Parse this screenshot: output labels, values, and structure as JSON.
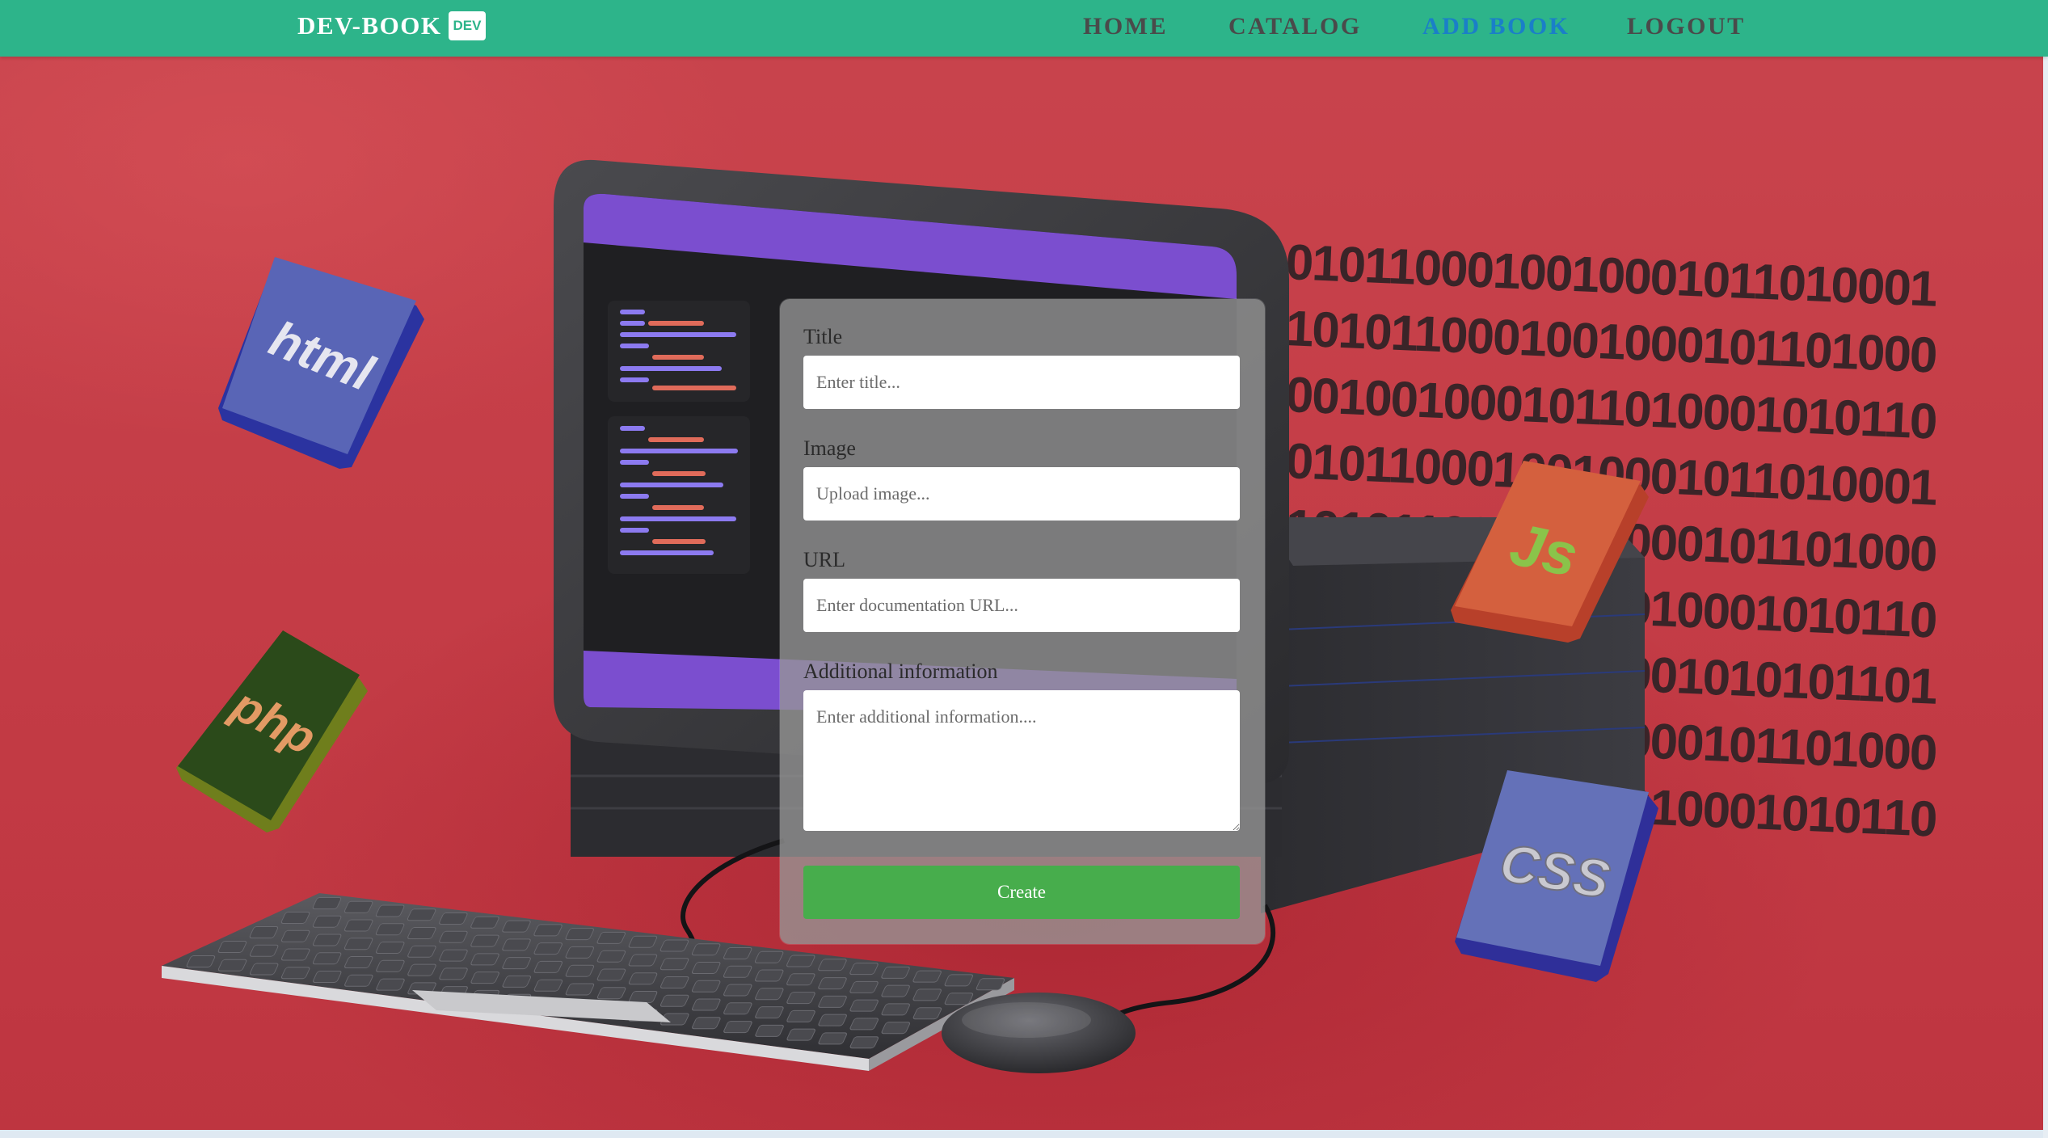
{
  "navbar": {
    "brand": "DEV-BOOK",
    "badge": "DEV",
    "links": [
      {
        "label": "HOME",
        "active": false
      },
      {
        "label": "CATALOG",
        "active": false
      },
      {
        "label": "ADD BOOK",
        "active": true
      },
      {
        "label": "LOGOUT",
        "active": false
      }
    ],
    "background_color": "#2db48a",
    "active_color": "#1a7fc8"
  },
  "form": {
    "title": {
      "label": "Title",
      "placeholder": "Enter title..."
    },
    "image": {
      "label": "Image",
      "placeholder": "Upload image..."
    },
    "url": {
      "label": "URL",
      "placeholder": "Enter documentation URL..."
    },
    "additional": {
      "label": "Additional information",
      "placeholder": "Enter additional information...."
    },
    "submit_label": "Create",
    "submit_color": "#47ad4c"
  },
  "scene": {
    "cubes": [
      {
        "label": "html",
        "icon": "html-cube-icon"
      },
      {
        "label": "php",
        "icon": "php-cube-icon"
      },
      {
        "label": "Js",
        "icon": "js-cube-icon"
      },
      {
        "label": "CSS",
        "icon": "css-cube-icon"
      }
    ],
    "binary_rows": [
      "0101100010010001011010001",
      "1010110001001000101101000",
      "0010010001011010001010110",
      "0101100010010001011010001",
      "1010110001001000101101000",
      "0010010001011010001010110",
      "0101100010010001010101101",
      "1010110001001000101101000",
      "0010010001011010001010110"
    ]
  }
}
